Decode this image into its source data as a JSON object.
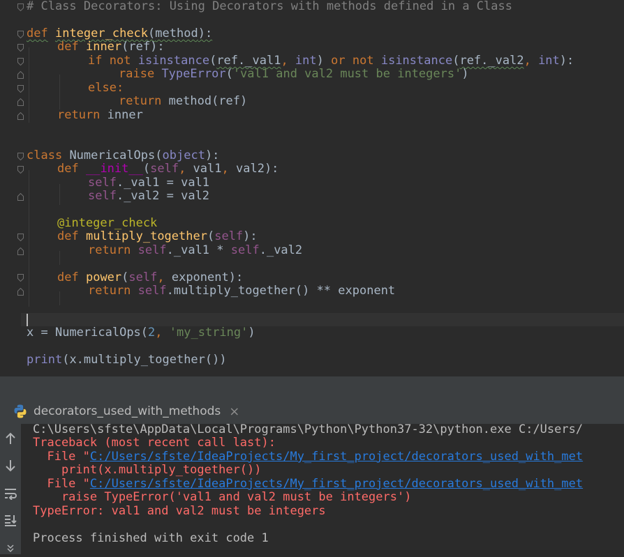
{
  "code": {
    "l1": "# Class Decorators: Using Decorators with methods defined in a Class",
    "def": "def",
    "class": "class",
    "if": "if",
    "not": "not",
    "or": "or",
    "else": "else",
    "return": "return",
    "raise": "raise",
    "integer_check": "integer_check",
    "method": "method",
    "inner": "inner",
    "ref": "ref",
    "isinstance": "isinstance",
    "ref_val1": "ref._val1",
    "ref_val2": "ref._val2",
    "int": "int",
    "TypeError": "TypeError",
    "err_msg": "'val1 and val2 must be integers'",
    "method_ref": "method(ref)",
    "NumericalOps": "NumericalOps",
    "object": "object",
    "init": "__init__",
    "self": "self",
    "val1": "val1",
    "val2": "val2",
    "_val1": "._val1",
    "_val2": "._val2",
    "decorator": "@integer_check",
    "multiply_together": "multiply_together",
    "power": "power",
    "exponent": "exponent",
    "x": "x",
    "num2": "2",
    "my_string": "'my_string'",
    "print": "print",
    "x_mult": "x.multiply_together()",
    "multiply_call": ".multiply_together()"
  },
  "run_panel": {
    "tab_label": "decorators_used_with_methods",
    "close_glyph": "×",
    "lines": {
      "cmd": "C:\\Users\\sfste\\AppData\\Local\\Programs\\Python\\Python37-32\\python.exe C:/Users/",
      "traceback": "Traceback (most recent call last):",
      "file_prefix": "  File \"",
      "file_path": "C:/Users/sfste/IdeaProjects/My_first_project/decorators_used_with_met",
      "code1": "    print(x.multiply_together())",
      "code2": "    raise TypeError('val1 and val2 must be integers')",
      "error": "TypeError: val1 and val2 must be integers",
      "exit": "Process finished with exit code 1"
    },
    "tools": [
      "arrow-up",
      "arrow-down",
      "soft-wrap",
      "scroll-to-end",
      "more"
    ]
  }
}
